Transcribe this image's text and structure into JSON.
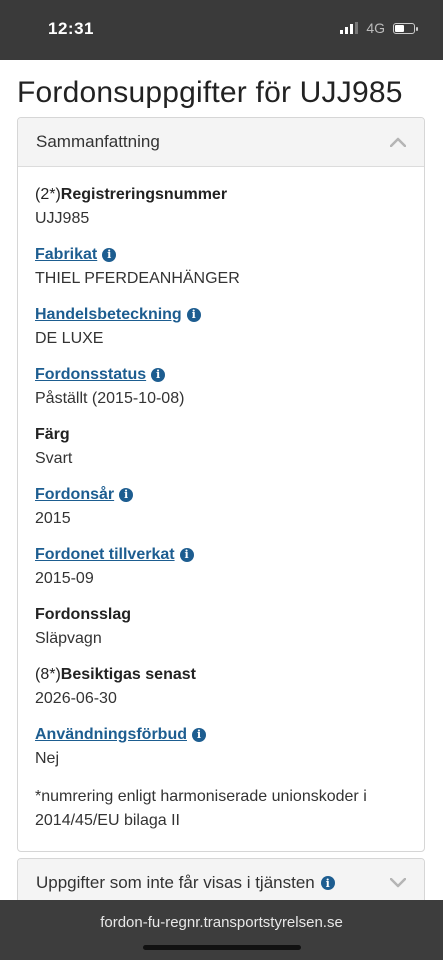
{
  "status": {
    "time": "12:31",
    "network": "4G"
  },
  "page": {
    "title": "Fordonsuppgifter för UJJ985"
  },
  "summary": {
    "header": "Sammanfattning",
    "fields": [
      {
        "prefix": "(2*)",
        "label": "Registreringsnummer",
        "value": "UJJ985"
      },
      {
        "prefix": "",
        "label": "Fabrikat",
        "value": "THIEL PFERDEANHÄNGER"
      },
      {
        "prefix": "",
        "label": "Handelsbeteckning",
        "value": "DE LUXE"
      },
      {
        "prefix": "",
        "label": "Fordonsstatus",
        "value": "Påställt (2015-10-08)"
      },
      {
        "prefix": "",
        "label": "Färg",
        "value": "Svart"
      },
      {
        "prefix": "",
        "label": "Fordonsår",
        "value": "2015"
      },
      {
        "prefix": "",
        "label": "Fordonet tillverkat",
        "value": "2015-09"
      },
      {
        "prefix": "",
        "label": "Fordonsslag",
        "value": "Släpvagn"
      },
      {
        "prefix": "(8*)",
        "label": "Besiktigas senast",
        "value": "2026-06-30"
      },
      {
        "prefix": "",
        "label": "Användningsförbud",
        "value": "Nej"
      }
    ],
    "footnote": "*numrering enligt harmoniserade unionskoder i 2014/45/EU bilaga II"
  },
  "second_panel": {
    "header": "Uppgifter som inte får visas i tjänsten"
  },
  "browser": {
    "url": "fordon-fu-regnr.transportstyrelsen.se"
  },
  "colors": {
    "link": "#1d5d90",
    "statusbar": "#3a3a3a",
    "panel_head": "#f4f4f4"
  }
}
